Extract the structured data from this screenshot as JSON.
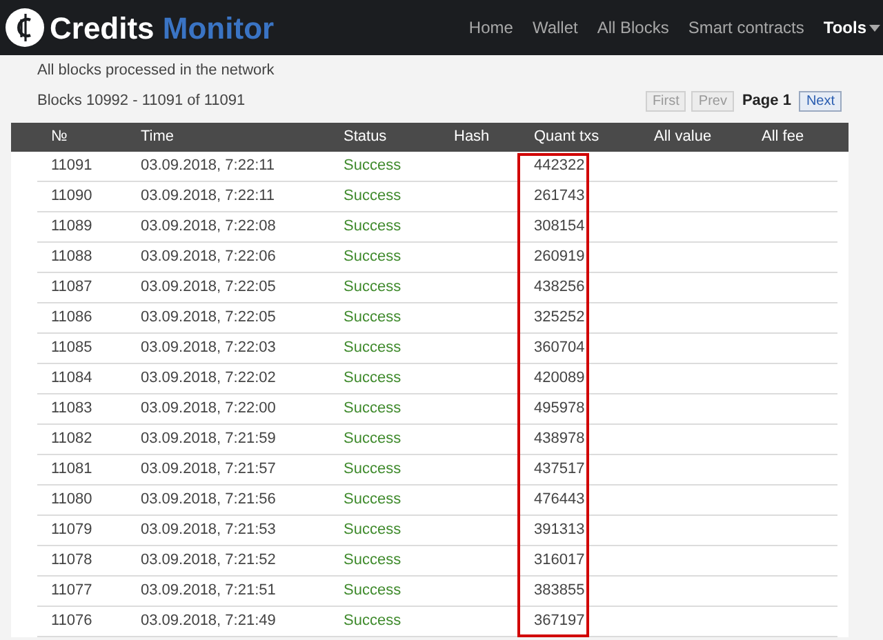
{
  "header": {
    "brand_first": "Credits",
    "brand_second": "Monitor",
    "nav": [
      {
        "label": "Home",
        "selected": false
      },
      {
        "label": "Wallet",
        "selected": false
      },
      {
        "label": "All Blocks",
        "selected": false
      },
      {
        "label": "Smart contracts",
        "selected": false
      },
      {
        "label": "Tools",
        "selected": true
      }
    ]
  },
  "subtitle": "All blocks processed in the network",
  "range": "Blocks 10992 - 11091 of 11091",
  "pager": [
    {
      "label": "First",
      "kind": "button",
      "disabled": true
    },
    {
      "label": "Prev",
      "kind": "button",
      "disabled": true
    },
    {
      "label": "Page 1",
      "kind": "current"
    },
    {
      "label": "Next",
      "kind": "button",
      "disabled": false
    }
  ],
  "table": {
    "columns": [
      {
        "label": "№",
        "highlighted": false
      },
      {
        "label": "Time",
        "highlighted": false
      },
      {
        "label": "Status",
        "highlighted": false
      },
      {
        "label": "Hash",
        "highlighted": false
      },
      {
        "label": "Quant txs",
        "highlighted": true
      },
      {
        "label": "All value",
        "highlighted": false
      },
      {
        "label": "All fee",
        "highlighted": false
      }
    ],
    "rows": [
      [
        "11091",
        "03.09.2018, 7:22:11",
        "Success",
        "442322"
      ],
      [
        "11090",
        "03.09.2018, 7:22:11",
        "Success",
        "261743"
      ],
      [
        "11089",
        "03.09.2018, 7:22:08",
        "Success",
        "308154"
      ],
      [
        "11088",
        "03.09.2018, 7:22:06",
        "Success",
        "260919"
      ],
      [
        "11087",
        "03.09.2018, 7:22:05",
        "Success",
        "438256"
      ],
      [
        "11086",
        "03.09.2018, 7:22:05",
        "Success",
        "325252"
      ],
      [
        "11085",
        "03.09.2018, 7:22:03",
        "Success",
        "360704"
      ],
      [
        "11084",
        "03.09.2018, 7:22:02",
        "Success",
        "420089"
      ],
      [
        "11083",
        "03.09.2018, 7:22:00",
        "Success",
        "495978"
      ],
      [
        "11082",
        "03.09.2018, 7:21:59",
        "Success",
        "438978"
      ],
      [
        "11081",
        "03.09.2018, 7:21:57",
        "Success",
        "437517"
      ],
      [
        "11080",
        "03.09.2018, 7:21:56",
        "Success",
        "476443"
      ],
      [
        "11079",
        "03.09.2018, 7:21:53",
        "Success",
        "391313"
      ],
      [
        "11078",
        "03.09.2018, 7:21:52",
        "Success",
        "316017"
      ],
      [
        "11077",
        "03.09.2018, 7:21:51",
        "Success",
        "383855"
      ],
      [
        "11076",
        "03.09.2018, 7:21:49",
        "Success",
        "367197"
      ]
    ]
  }
}
